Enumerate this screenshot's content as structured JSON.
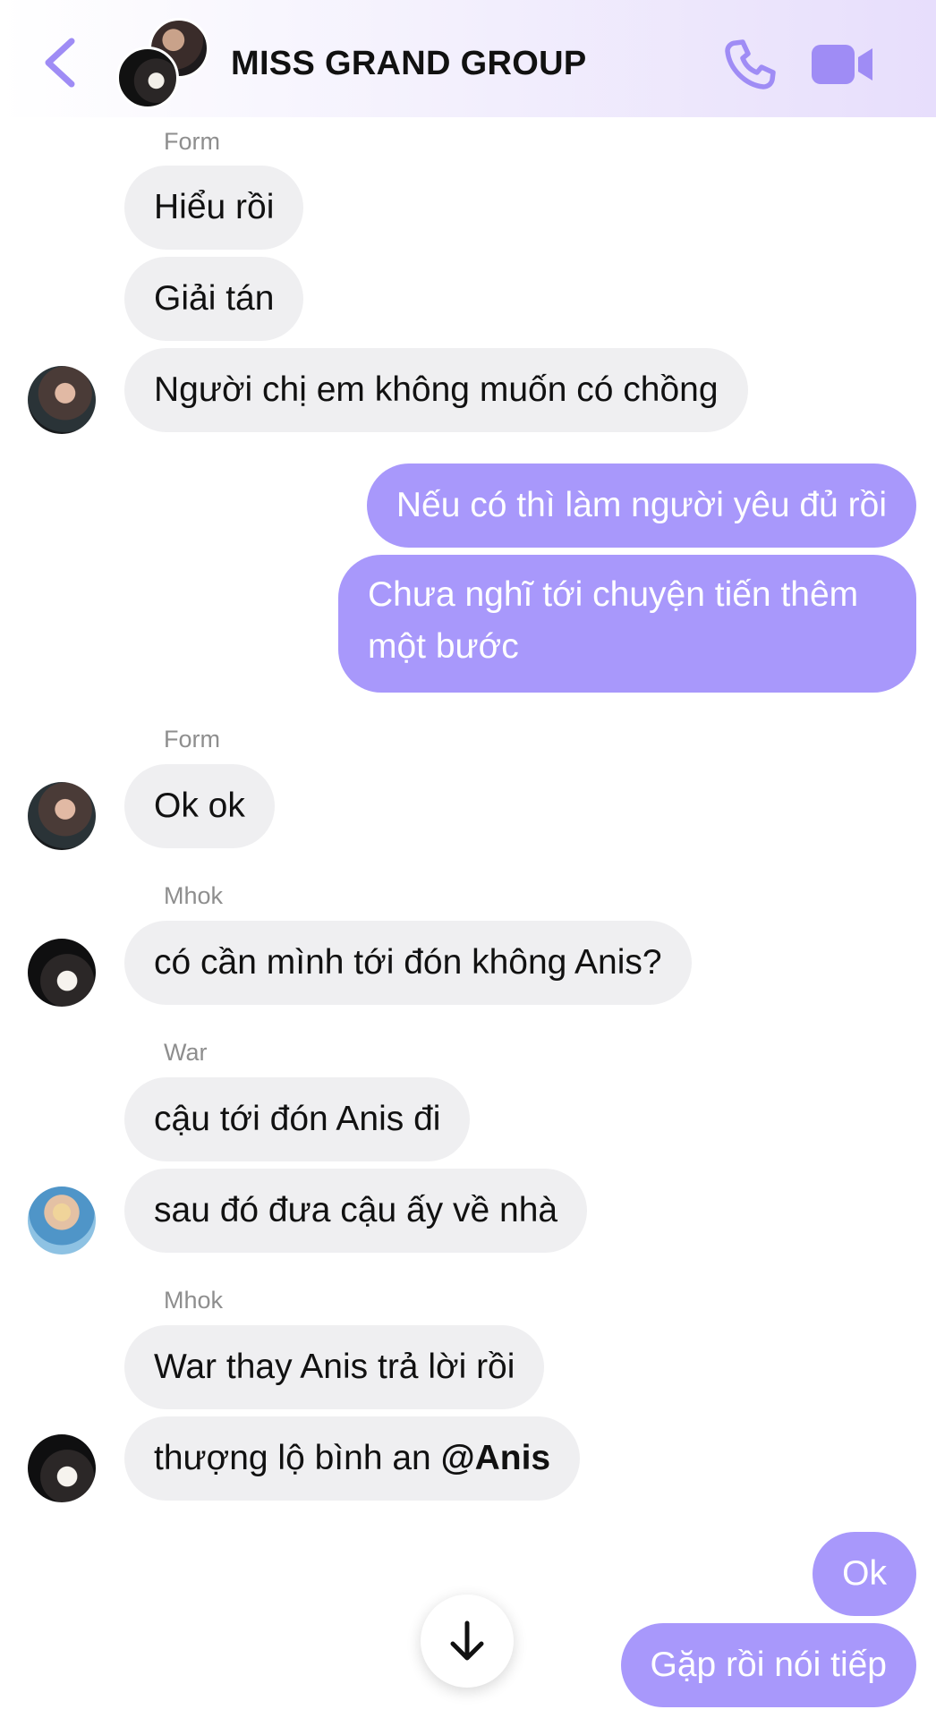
{
  "header": {
    "title": "MISS GRAND GROUP",
    "back_icon": "chevron-left-icon",
    "call_icon": "phone-icon",
    "video_icon": "video-camera-icon"
  },
  "colors": {
    "accent": "#a898fb",
    "icon": "#9f8cf5",
    "incoming_bubble": "#efeff1",
    "outgoing_text": "#ffffff"
  },
  "messages": [
    {
      "sender": "Form",
      "direction": "in",
      "text": "Hiểu rồi"
    },
    {
      "direction": "in",
      "text": "Giải tán"
    },
    {
      "direction": "in",
      "text": "Người chị em không muốn có chồng"
    },
    {
      "direction": "out",
      "text": "Nếu có thì làm người yêu đủ rồi"
    },
    {
      "direction": "out",
      "text": "Chưa nghĩ tới chuyện tiến thêm một bước"
    },
    {
      "sender": "Form",
      "direction": "in",
      "text": "Ok ok"
    },
    {
      "sender": "Mhok",
      "direction": "in",
      "text": "có cần mình tới đón không Anis?"
    },
    {
      "sender": "War",
      "direction": "in",
      "text": "cậu tới đón Anis đi"
    },
    {
      "direction": "in",
      "text": "sau đó đưa cậu ấy về nhà"
    },
    {
      "sender": "Mhok",
      "direction": "in",
      "text": "War thay Anis trả lời rồi"
    },
    {
      "direction": "in",
      "text": "thượng lộ bình an ",
      "mention": "@Anis"
    },
    {
      "direction": "out",
      "text": "Ok"
    },
    {
      "direction": "out",
      "text": "Gặp rồi nói tiếp"
    }
  ],
  "scroll_button": {
    "icon": "arrow-down-icon"
  }
}
